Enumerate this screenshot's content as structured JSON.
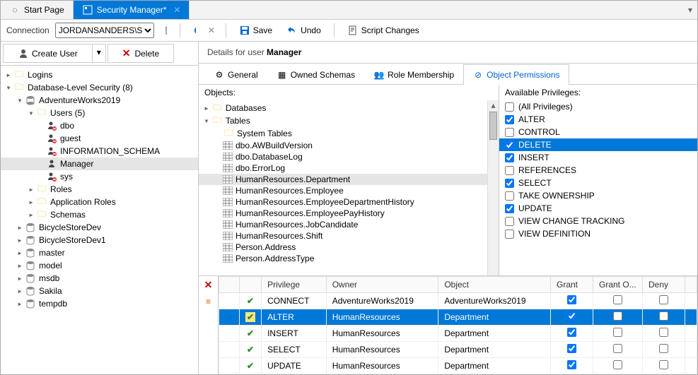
{
  "tabs": {
    "start": "Start Page",
    "security": "Security Manager*"
  },
  "toolbar": {
    "connection_label": "Connection",
    "connection_value": "JORDANSANDERS\\SQL...",
    "save": "Save",
    "undo": "Undo",
    "script": "Script Changes"
  },
  "left_toolbar": {
    "create": "Create User",
    "delete": "Delete"
  },
  "tree": {
    "logins": "Logins",
    "dbsec": "Database-Level Security  (8)",
    "adv": "AdventureWorks2019",
    "users": "Users (5)",
    "user_dbo": "dbo",
    "user_guest": "guest",
    "user_info": "INFORMATION_SCHEMA",
    "user_manager": "Manager",
    "user_sys": "sys",
    "roles": "Roles",
    "app_roles": "Application Roles",
    "schemas": "Schemas",
    "db_bsd": "BicycleStoreDev",
    "db_bsd1": "BicycleStoreDev1",
    "db_master": "master",
    "db_model": "model",
    "db_msdb": "msdb",
    "db_sakila": "Sakila",
    "db_tempdb": "tempdb"
  },
  "details": {
    "prefix": "Details for user ",
    "name": "Manager"
  },
  "subtabs": {
    "general": "General",
    "owned": "Owned Schemas",
    "role": "Role Membership",
    "perms": "Object Permissions"
  },
  "objects": {
    "hdr": "Objects:",
    "databases": "Databases",
    "tables": "Tables",
    "system": "System Tables",
    "t1": "dbo.AWBuildVersion",
    "t2": "dbo.DatabaseLog",
    "t3": "dbo.ErrorLog",
    "t4": "HumanResources.Department",
    "t5": "HumanResources.Employee",
    "t6": "HumanResources.EmployeeDepartmentHistory",
    "t7": "HumanResources.EmployeePayHistory",
    "t8": "HumanResources.JobCandidate",
    "t9": "HumanResources.Shift",
    "t10": "Person.Address",
    "t11": "Person.AddressType"
  },
  "privs": {
    "hdr": "Available Privileges:",
    "all": "(All Privileges)",
    "p1": "ALTER",
    "p2": "CONTROL",
    "p3": "DELETE",
    "p4": "INSERT",
    "p5": "REFERENCES",
    "p6": "SELECT",
    "p7": "TAKE OWNERSHIP",
    "p8": "UPDATE",
    "p9": "VIEW CHANGE TRACKING",
    "p10": "VIEW DEFINITION"
  },
  "grid": {
    "cols": {
      "priv": "Privilege",
      "owner": "Owner",
      "obj": "Object",
      "grant": "Grant",
      "granto": "Grant O...",
      "deny": "Deny"
    },
    "rows": [
      {
        "priv": "CONNECT",
        "owner": "AdventureWorks2019",
        "obj": "AdventureWorks2019",
        "grant": true,
        "sel": false,
        "ind": "check"
      },
      {
        "priv": "ALTER",
        "owner": "HumanResources",
        "obj": "Department",
        "grant": true,
        "sel": true,
        "ind": "arrow"
      },
      {
        "priv": "INSERT",
        "owner": "HumanResources",
        "obj": "Department",
        "grant": true,
        "sel": false,
        "ind": "check"
      },
      {
        "priv": "SELECT",
        "owner": "HumanResources",
        "obj": "Department",
        "grant": true,
        "sel": false,
        "ind": "check"
      },
      {
        "priv": "UPDATE",
        "owner": "HumanResources",
        "obj": "Department",
        "grant": true,
        "sel": false,
        "ind": "check"
      }
    ]
  }
}
